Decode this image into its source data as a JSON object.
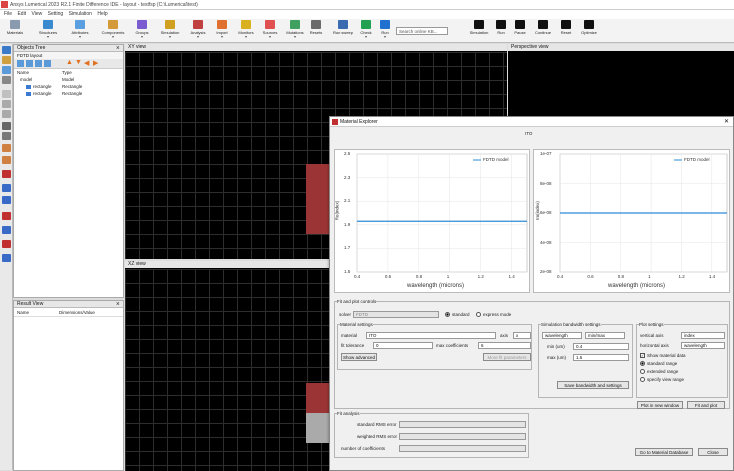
{
  "window_title": "Ansys Lumerical 2023 R2.1 Finite Difference IDE - layout - testfsp (C:\\Lumerical\\test)",
  "menu": [
    "File",
    "Edit",
    "View",
    "Setting",
    "Simulation",
    "Help"
  ],
  "toolbar": {
    "groups": [
      "Materials",
      "Structures",
      "Attributes",
      "Components",
      "Groups",
      "Simulation",
      "Analysis",
      "Import",
      "Monitors",
      "Sources",
      "Mutations",
      "Resets"
    ],
    "search_placeholder": "Search online KB...",
    "right_buttons": [
      "Simulation",
      "Run",
      "Pause",
      "Continue",
      "Reset",
      "Optimize"
    ],
    "run_labels": [
      "Run sweep",
      "Check",
      "Run"
    ]
  },
  "objects_tree": {
    "title": "Objects Tree",
    "subtitle": "FDTD layout",
    "col_name": "Name",
    "col_type": "Type",
    "rows": [
      {
        "name": "model",
        "type": "Model"
      },
      {
        "name": "rectangle",
        "type": "Rectangle"
      },
      {
        "name": "rectangle",
        "type": "Rectangle"
      }
    ]
  },
  "result_view": {
    "title": "Result View",
    "col_name": "Name",
    "col_value": "Dimensions/Value"
  },
  "views": {
    "xy": "XY view",
    "perspective": "Perspective view",
    "xz": "XZ view"
  },
  "dialog": {
    "title": "Material Explorer",
    "subtitle": "ITO",
    "plot1": {
      "legend": "FDTD model",
      "ylabel": "Re(index)",
      "xlabel": "wavelength (microns)",
      "yticks": [
        "2.5",
        "2.3",
        "2.1",
        "1.9",
        "1.7",
        "1.5"
      ],
      "xticks": [
        "0.4",
        "0.6",
        "0.8",
        "1",
        "1.2",
        "1.4"
      ],
      "value": 1.93,
      "ylim": [
        1.5,
        2.5
      ],
      "xlim": [
        0.4,
        1.5
      ]
    },
    "plot2": {
      "legend": "FDTD model",
      "ylabel": "Im(index)",
      "xlabel": "wavelength (microns)",
      "yticks": [
        "1e-07",
        "8e-08",
        "6e-08",
        "4e-08",
        "2e-08"
      ],
      "xticks": [
        "0.4",
        "0.6",
        "0.8",
        "1",
        "1.2",
        "1.4"
      ],
      "value": 6e-08,
      "ylim": [
        2e-08,
        1e-07
      ],
      "xlim": [
        0.4,
        1.5
      ]
    },
    "fit_controls": "Fit and plot controls",
    "solver_label": "solver",
    "solver_value": "FDTD",
    "radio_standard": "standard",
    "radio_express": "express mode",
    "material_settings": "Material settings",
    "material_label": "material",
    "material_value": "ITO",
    "axis_label": "axis",
    "axis_value": "x",
    "fit_tolerance_label": "fit tolerance",
    "fit_tolerance_value": "0",
    "max_coeff_label": "max coefficients",
    "max_coeff_value": "6",
    "show_advanced": "Show advanced",
    "more_fit": "More fit parameters",
    "sim_bw": "Simulation bandwidth settings",
    "wl_mode": "wavelength",
    "freq_mode": "min/max",
    "min_label": "min (um)",
    "min_value": "0.4",
    "max_label": "max (um)",
    "max_value": "1.5",
    "save_bw": "Save bandwidth and settings",
    "plot_settings": "Plot settings",
    "vertical_axis_label": "vertical axis",
    "vertical_axis_value": "index",
    "horizontal_axis_label": "horizontal axis",
    "horizontal_axis_value": "wavelength",
    "show_material_data": "Show material data",
    "standard_range": "standard range",
    "extended_range": "extended range",
    "specify_range": "specify view range",
    "plot_new_window": "Plot in new window",
    "fit_and_plot": "Fit and plot",
    "fit_analysis": "Fit analysis",
    "std_rms": "standard RMS error",
    "wt_rms": "weighted RMS error",
    "num_coeff": "number of coefficients",
    "goto_db": "Go to Material Database",
    "close": "Close"
  },
  "colors": {
    "accent": "#2e8bd6",
    "red_block": "#9b3535",
    "bg_dark": "#000000"
  }
}
